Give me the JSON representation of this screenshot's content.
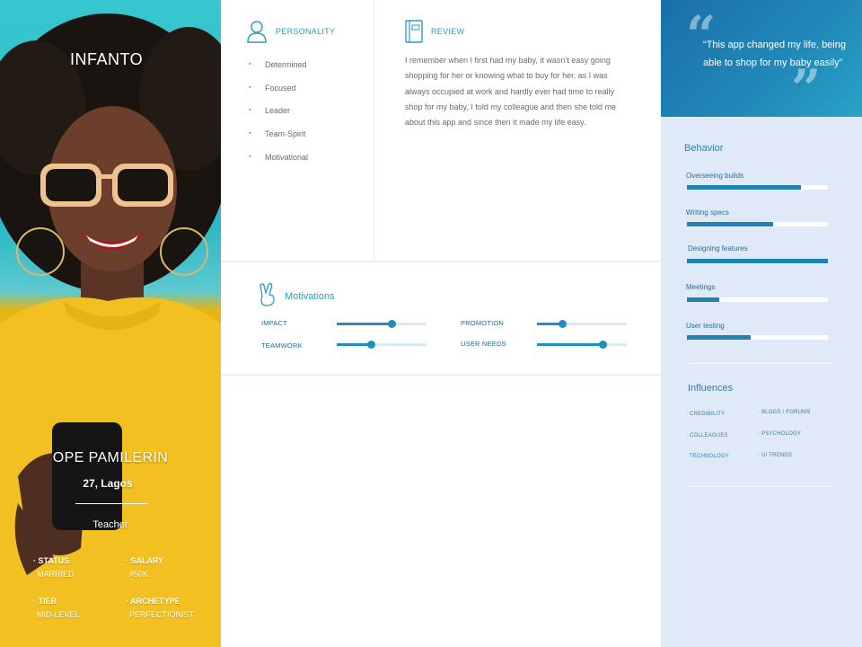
{
  "brand": "INFANTO",
  "persona": {
    "name": "OPE PAMILERIN",
    "age_location": "27, Lagos",
    "job": "Teacher",
    "stats": [
      {
        "key": "STATUS",
        "value": "MARRIED"
      },
      {
        "key": "SALARY",
        "value": "#50K"
      },
      {
        "key": "TIER",
        "value": "MID-LEVEL"
      },
      {
        "key": "ARCHETYPE",
        "value": "PERFECTIONIST"
      }
    ]
  },
  "personality": {
    "title": "PERSONALITY",
    "icon": "person-icon",
    "traits": [
      "Determined",
      "Focused",
      "Leader",
      "Team-Spirit",
      "Motivational"
    ]
  },
  "review": {
    "title": "REVIEW",
    "icon": "notebook-icon",
    "text": "I remember when I first had my baby, it wasn’t easy going shopping for her or knowing what to buy for her, as I was always occupied at work and hardly ever had time to really shop for my baby, I told my colleague and then she told me about this app and since then it made my life easy."
  },
  "motivations": {
    "title": "Motivations",
    "icon": "peace-hand-icon",
    "items": [
      {
        "label": "IMPACT",
        "value": 0.61
      },
      {
        "label": "PROMOTION",
        "value": 0.28
      },
      {
        "label": "TEAMWORK",
        "value": 0.38
      },
      {
        "label": "USER NEEDS",
        "value": 0.73
      }
    ]
  },
  "quote": {
    "text": "“This app changed my life, being able to shop for my baby easily”"
  },
  "behavior": {
    "title": "Behavior",
    "items": [
      {
        "label": "Overseeing builds",
        "value": 0.81
      },
      {
        "label": "Writing specs",
        "value": 0.61
      },
      {
        "label": "Designing features",
        "value": 1.0
      },
      {
        "label": "Meetings",
        "value": 0.23
      },
      {
        "label": "User testing",
        "value": 0.45
      }
    ]
  },
  "influences": {
    "title": "Influences",
    "items": [
      "CREDIBILITY",
      "BLOGS / FORUMS",
      "COLLEAGUES",
      "PSYCHOLOGY",
      "TECHNOLOGY",
      "UI TRENDS"
    ]
  },
  "colors": {
    "accent": "#2e9bbf",
    "bar": "#2182b6",
    "panel": "#dfe9f7",
    "quote_bg": "#1a6fa9",
    "shirt": "#f3c21e",
    "sky": "#38c7d0"
  }
}
